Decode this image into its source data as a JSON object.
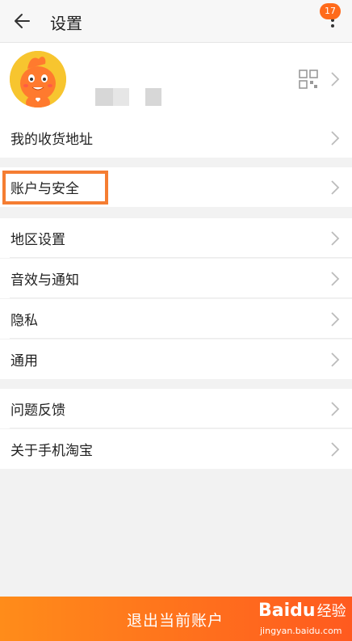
{
  "header": {
    "title": "设置",
    "badge_count": "17",
    "icons": {
      "back": "arrow-left-icon",
      "more": "more-vertical-icon"
    }
  },
  "profile": {
    "avatar_icon": "mascot-avatar-icon",
    "qr_icon": "qr-code-icon"
  },
  "sections": [
    {
      "items": [
        {
          "label": "我的收货地址"
        }
      ]
    },
    {
      "items": [
        {
          "label": "账户与安全",
          "highlighted": true
        }
      ]
    },
    {
      "items": [
        {
          "label": "地区设置"
        },
        {
          "label": "音效与通知"
        },
        {
          "label": "隐私"
        },
        {
          "label": "通用"
        }
      ]
    },
    {
      "items": [
        {
          "label": "问题反馈"
        },
        {
          "label": "关于手机淘宝"
        }
      ]
    }
  ],
  "footer": {
    "logout_label": "退出当前账户",
    "watermark_brand": "Baidu",
    "watermark_brand_ext": "经验",
    "watermark_url": "jingyan.baidu.com"
  },
  "colors": {
    "accent": "#ff6a1a",
    "highlight_border": "#f57d32",
    "background": "#f2f2f2"
  }
}
